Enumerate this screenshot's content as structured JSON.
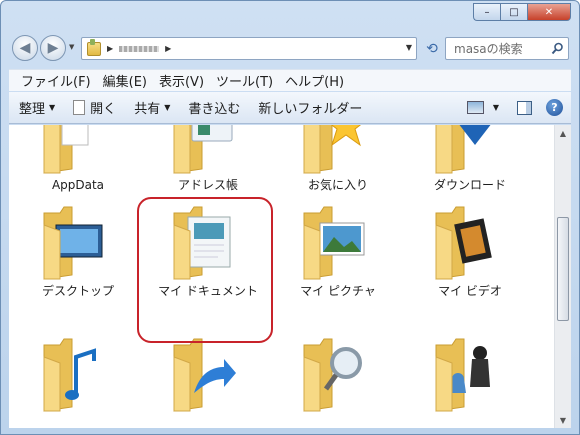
{
  "window": {
    "caption_buttons": [
      {
        "name": "minimize-button",
        "glyph": "–"
      },
      {
        "name": "maximize-button",
        "glyph": "□"
      },
      {
        "name": "close-button",
        "glyph": "✕"
      }
    ]
  },
  "nav": {
    "back_glyph": "◀",
    "forward_glyph": "▶",
    "refresh_glyph": "⟲",
    "search_placeholder": "masaの検索"
  },
  "menu": [
    "ファイル(F)",
    "編集(E)",
    "表示(V)",
    "ツール(T)",
    "ヘルプ(H)"
  ],
  "toolbar": {
    "organize": "整理",
    "open": "開く",
    "share": "共有",
    "burn": "書き込む",
    "new_folder": "新しいフォルダー",
    "help": "?"
  },
  "folders": [
    {
      "label": "AppData",
      "overlay": "papers"
    },
    {
      "label": "アドレス帳",
      "overlay": "contact"
    },
    {
      "label": "お気に入り",
      "overlay": "star"
    },
    {
      "label": "ダウンロード",
      "overlay": "arrow"
    },
    {
      "label": "デスクトップ",
      "overlay": "monitor"
    },
    {
      "label": "マイ ドキュメント",
      "overlay": "document"
    },
    {
      "label": "マイ ピクチャ",
      "overlay": "picture"
    },
    {
      "label": "マイ ビデオ",
      "overlay": "film"
    },
    {
      "label": "",
      "overlay": "music"
    },
    {
      "label": "",
      "overlay": "shortcut"
    },
    {
      "label": "",
      "overlay": "search"
    },
    {
      "label": "",
      "overlay": "games"
    }
  ],
  "colors": {
    "folder_front": "#f7d985",
    "folder_back": "#e8bf55",
    "highlight": "#c8232a"
  }
}
